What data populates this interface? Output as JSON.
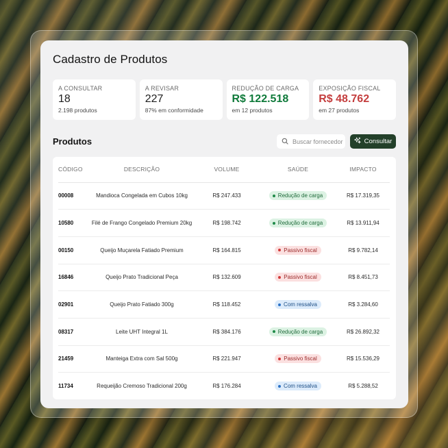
{
  "header": {
    "title": "Cadastro de Produtos"
  },
  "stats": [
    {
      "label": "A CONSULTAR",
      "value": "18",
      "sub": "2.198 produtos",
      "tone": "neutral"
    },
    {
      "label": "A REVISAR",
      "value": "227",
      "sub": "87% em conformidade",
      "tone": "neutral"
    },
    {
      "label": "REDUÇÃO DE CARGA",
      "value": "R$ 122.518",
      "sub": "em 12 produtos",
      "tone": "green"
    },
    {
      "label": "EXPOSIÇÃO FISCAL",
      "value": "R$ 48.762",
      "sub": "em 27 produtos",
      "tone": "red"
    }
  ],
  "products": {
    "section_title": "Produtos",
    "search": {
      "placeholder": "Buscar fornecedor",
      "value": ""
    },
    "consult_button": "Consultar",
    "columns": [
      "CÓDIGO",
      "DESCRIÇÃO",
      "VOLUME",
      "SAÚDE",
      "IMPACTO"
    ],
    "rows": [
      {
        "code": "00008",
        "description": "Mandioca Congelada em Cubos 10kg",
        "volume": "R$ 247.433",
        "health": "Redução de carga",
        "health_tone": "green",
        "impact": "R$ 17.319,35"
      },
      {
        "code": "10580",
        "description": "Filé de Frango Congelado Premium 20kg",
        "volume": "R$ 198.742",
        "health": "Redução de carga",
        "health_tone": "green",
        "impact": "R$ 13.911,94"
      },
      {
        "code": "00150",
        "description": "Queijo Muçarela Fatiado Premium",
        "volume": "R$ 164.815",
        "health": "Passivo fiscal",
        "health_tone": "red",
        "impact": "R$ 9.782,14"
      },
      {
        "code": "16846",
        "description": "Queijo Prato Tradicional Peça",
        "volume": "R$ 132.609",
        "health": "Passivo fiscal",
        "health_tone": "red",
        "impact": "R$ 8.451,73"
      },
      {
        "code": "02901",
        "description": "Queijo Prato Fatiado 300g",
        "volume": "R$ 118.452",
        "health": "Com ressalva",
        "health_tone": "blue",
        "impact": "R$ 3.284,60"
      },
      {
        "code": "08317",
        "description": "Leite UHT Integral 1L",
        "volume": "R$ 384.176",
        "health": "Redução de carga",
        "health_tone": "green",
        "impact": "R$ 26.892,32"
      },
      {
        "code": "21459",
        "description": "Manteiga Extra com Sal 500g",
        "volume": "R$ 221.947",
        "health": "Passivo fiscal",
        "health_tone": "red",
        "impact": "R$ 15.536,29"
      },
      {
        "code": "11734",
        "description": "Requeijão Cremoso Tradicional 200g",
        "volume": "R$ 176.284",
        "health": "Com ressalva",
        "health_tone": "blue",
        "impact": "R$ 5.288,52"
      }
    ]
  },
  "icons": {
    "search": "search-icon",
    "consult": "sparkle-icon"
  },
  "colors": {
    "primary_button": "#23402a",
    "positive": "#0f7a3a",
    "negative": "#c43d3d",
    "info": "#2d73c7"
  }
}
